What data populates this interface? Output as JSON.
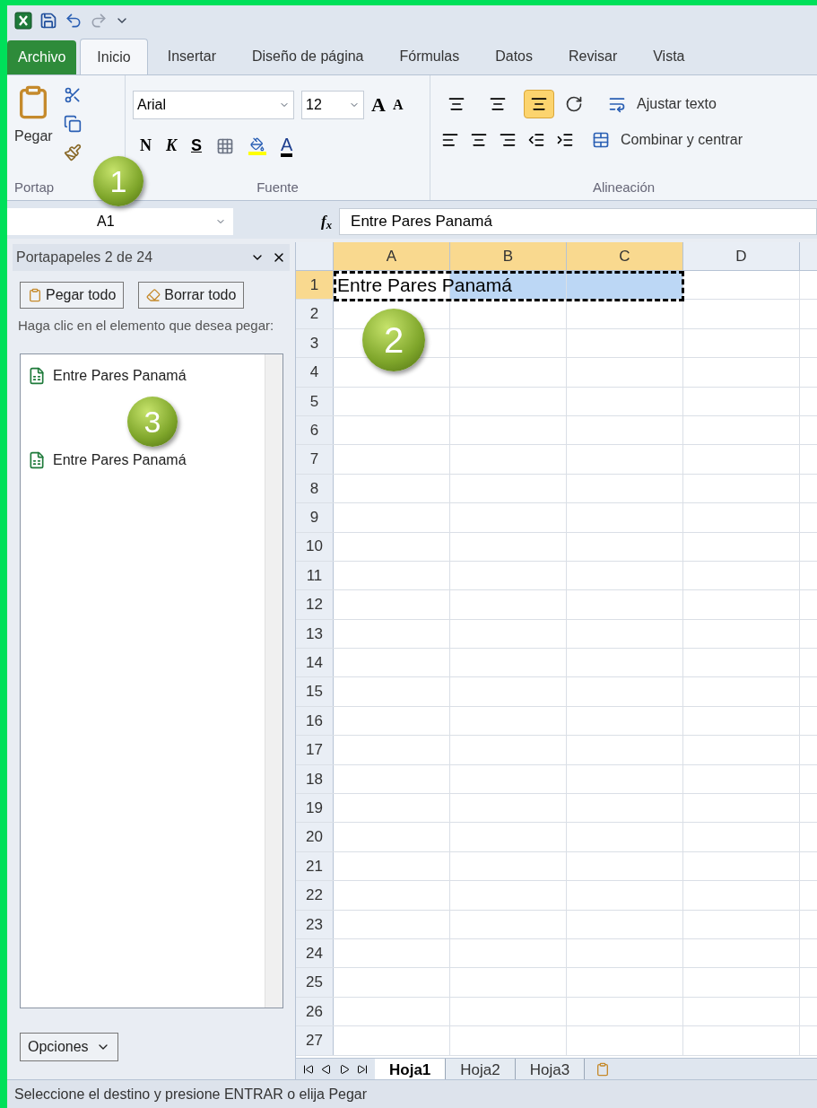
{
  "ribbon_tabs": [
    {
      "label": "Archivo",
      "kind": "file",
      "selected": false
    },
    {
      "label": "Inicio",
      "kind": "tab",
      "selected": true
    },
    {
      "label": "Insertar",
      "kind": "tab",
      "selected": false
    },
    {
      "label": "Diseño de página",
      "kind": "tab",
      "selected": false
    },
    {
      "label": "Fórmulas",
      "kind": "tab",
      "selected": false
    },
    {
      "label": "Datos",
      "kind": "tab",
      "selected": false
    },
    {
      "label": "Revisar",
      "kind": "tab",
      "selected": false
    },
    {
      "label": "Vista",
      "kind": "tab",
      "selected": false
    }
  ],
  "clipboard_group": {
    "paste_label": "Pegar",
    "group_label": "Portap"
  },
  "font_group": {
    "font_name": "Arial",
    "font_size": "12",
    "grow": "A",
    "shrink": "A",
    "bold": "N",
    "italic": "K",
    "underline": "S",
    "font_color": "A",
    "group_label": "Fuente"
  },
  "alignment_group": {
    "vertical": [
      {
        "selected": false
      },
      {
        "selected": false
      },
      {
        "selected": true
      }
    ],
    "wrap_text": "Ajustar texto",
    "merge_center": "Combinar y centrar",
    "group_label": "Alineación"
  },
  "formula_bar": {
    "name_box": "A1",
    "fx": "f$_{x}$",
    "formula": "Entre Pares Panamá"
  },
  "task_pane": {
    "title": "Portapapeles 2 de 24",
    "buttons": [
      "Pegar todo",
      "Borrar todo"
    ],
    "instruction": "Haga clic en el elemento que desea pegar:",
    "items": [
      {
        "label": "Entre Pares Panamá"
      },
      {
        "label": "Entre Pares Panamá"
      }
    ],
    "options": "Opciones"
  },
  "sheet": {
    "columns": [
      {
        "label": "A",
        "selected": true
      },
      {
        "label": "B",
        "selected": true
      },
      {
        "label": "C",
        "selected": true
      },
      {
        "label": "D",
        "selected": false
      }
    ],
    "rows": [
      {
        "label": "1",
        "selected": true
      },
      {
        "label": "2",
        "selected": false
      },
      {
        "label": "3",
        "selected": false
      },
      {
        "label": "4",
        "selected": false
      },
      {
        "label": "5",
        "selected": false
      },
      {
        "label": "6",
        "selected": false
      },
      {
        "label": "7",
        "selected": false
      },
      {
        "label": "8",
        "selected": false
      },
      {
        "label": "9",
        "selected": false
      },
      {
        "label": "10",
        "selected": false
      },
      {
        "label": "11",
        "selected": false
      },
      {
        "label": "12",
        "selected": false
      },
      {
        "label": "13",
        "selected": false
      },
      {
        "label": "14",
        "selected": false
      },
      {
        "label": "15",
        "selected": false
      },
      {
        "label": "16",
        "selected": false
      },
      {
        "label": "17",
        "selected": false
      },
      {
        "label": "18",
        "selected": false
      },
      {
        "label": "19",
        "selected": false
      },
      {
        "label": "20",
        "selected": false
      },
      {
        "label": "21",
        "selected": false
      },
      {
        "label": "22",
        "selected": false
      },
      {
        "label": "23",
        "selected": false
      },
      {
        "label": "24",
        "selected": false
      },
      {
        "label": "25",
        "selected": false
      },
      {
        "label": "26",
        "selected": false
      },
      {
        "label": "27",
        "selected": false
      }
    ],
    "cell_a1": "Entre Pares Panamá"
  },
  "sheet_tabs": [
    {
      "label": "Hoja1",
      "selected": true
    },
    {
      "label": "Hoja2",
      "selected": false
    },
    {
      "label": "Hoja3",
      "selected": false
    }
  ],
  "status_bar": "Seleccione el destino y presione ENTRAR o elija Pegar",
  "callouts": [
    "1",
    "2",
    "3"
  ]
}
